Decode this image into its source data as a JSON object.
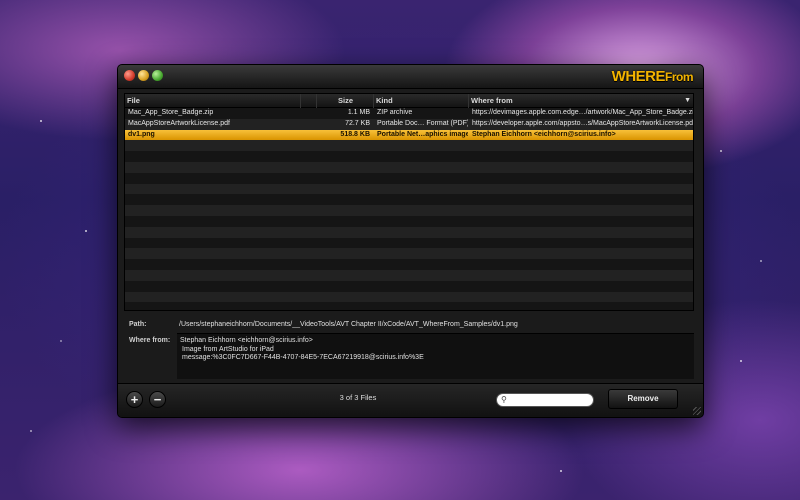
{
  "app": {
    "logo_main": "WHERE",
    "logo_suffix": "From"
  },
  "table": {
    "headers": {
      "file": "File",
      "size": "Size",
      "kind": "Kind",
      "where": "Where from"
    },
    "rows": [
      {
        "file": "Mac_App_Store_Badge.zip",
        "size": "1.1 MB",
        "kind": "ZIP archive",
        "where": "https://devimages.apple.com.edge…/artwork/Mac_App_Store_Badge.zip"
      },
      {
        "file": "MacAppStoreArtworkLicense.pdf",
        "size": "72.7 KB",
        "kind": "Portable Doc… Format (PDF)",
        "where": "https://developer.apple.com/appsto…s/MacAppStoreArtworkLicense.pdf"
      },
      {
        "file": "dv1.png",
        "size": "518.8 KB",
        "kind": "Portable Net…aphics image",
        "where": "Stephan Eichhorn <eichhorn@scirius.info>"
      }
    ]
  },
  "details": {
    "path_label": "Path:",
    "path_value": "/Users/stephaneichhorn/Documents/__VideoTools/AVT Chapter II/xCode/AVT_WhereFrom_Samples/dv1.png",
    "where_label": "Where from:",
    "where_lines": [
      "Stephan Eichhorn <eichhorn@scirius.info>",
      "Image from ArtStudio for iPad",
      "message:%3C0FC7D667-F44B-4707-84E5-7ECA67219918@scirius.info%3E"
    ]
  },
  "footer": {
    "add_symbol": "+",
    "remove_symbol": "−",
    "files_count": "3  of  3  Files",
    "search_value": "",
    "remove_label": "Remove"
  }
}
